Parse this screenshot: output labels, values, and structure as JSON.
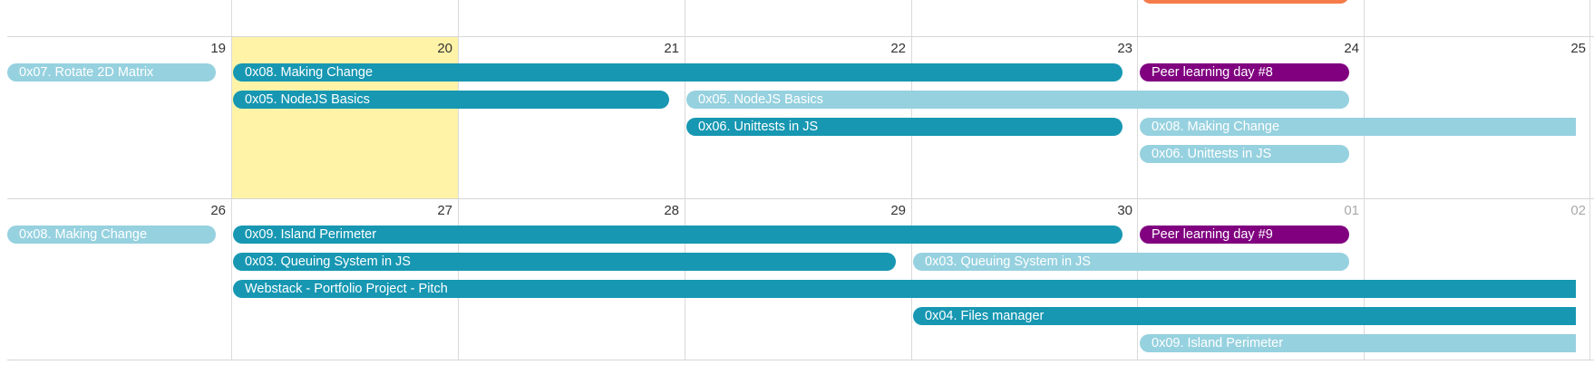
{
  "colors": {
    "dark_event": "#1797b2",
    "light_event": "#96d1df",
    "peer_learning": "#800080",
    "today_highlight": "#fff3a8",
    "partial_event_top": "#f57c4a"
  },
  "weeks": [
    {
      "days": [
        "19",
        "20",
        "21",
        "22",
        "23",
        "24",
        "25"
      ],
      "today_index": 1,
      "events": [
        {
          "label": "0x07. Rotate 2D Matrix",
          "style": "light"
        },
        {
          "label": "0x08. Making Change",
          "style": "dark"
        },
        {
          "label": "Peer learning day #8",
          "style": "purple"
        },
        {
          "label": "0x05. NodeJS Basics",
          "style": "dark"
        },
        {
          "label": "0x05. NodeJS Basics",
          "style": "light"
        },
        {
          "label": "0x06. Unittests in JS",
          "style": "dark"
        },
        {
          "label": "0x08. Making Change",
          "style": "light"
        },
        {
          "label": "0x06. Unittests in JS",
          "style": "light"
        }
      ]
    },
    {
      "days": [
        "26",
        "27",
        "28",
        "29",
        "30",
        "01",
        "02"
      ],
      "events": [
        {
          "label": "0x08. Making Change",
          "style": "light"
        },
        {
          "label": "0x09. Island Perimeter",
          "style": "dark"
        },
        {
          "label": "Peer learning day #9",
          "style": "purple"
        },
        {
          "label": "0x03. Queuing System in JS",
          "style": "dark"
        },
        {
          "label": "0x03. Queuing System in JS",
          "style": "light"
        },
        {
          "label": "Webstack - Portfolio Project - Pitch",
          "style": "dark"
        },
        {
          "label": "0x04. Files manager",
          "style": "dark"
        },
        {
          "label": "0x09. Island Perimeter",
          "style": "light"
        }
      ]
    }
  ]
}
